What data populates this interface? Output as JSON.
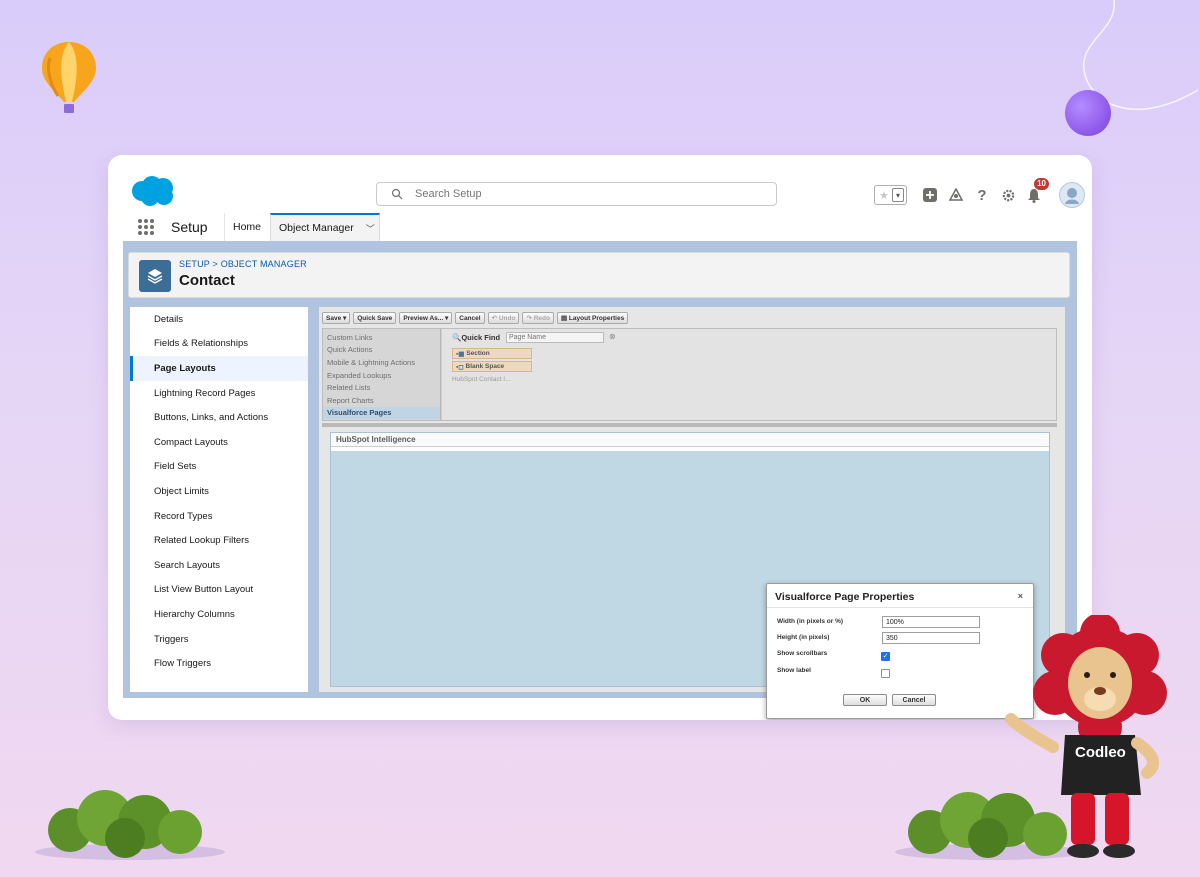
{
  "header": {
    "search_placeholder": "Search Setup",
    "notification_count": "10",
    "icons": [
      "star-icon",
      "add-icon",
      "trailhead-icon",
      "help-icon",
      "settings-icon",
      "bell-icon",
      "avatar"
    ]
  },
  "nav": {
    "app_name": "Setup",
    "tabs": [
      {
        "label": "Home"
      },
      {
        "label": "Object Manager"
      }
    ]
  },
  "page_header": {
    "breadcrumb": "SETUP > OBJECT MANAGER",
    "title": "Contact"
  },
  "sidebar": {
    "items": [
      {
        "label": "Details"
      },
      {
        "label": "Fields & Relationships"
      },
      {
        "label": "Page Layouts",
        "active": true
      },
      {
        "label": "Lightning Record Pages"
      },
      {
        "label": "Buttons, Links, and Actions"
      },
      {
        "label": "Compact Layouts"
      },
      {
        "label": "Field Sets"
      },
      {
        "label": "Object Limits"
      },
      {
        "label": "Record Types"
      },
      {
        "label": "Related Lookup Filters"
      },
      {
        "label": "Search Layouts"
      },
      {
        "label": "List View Button Layout"
      },
      {
        "label": "Hierarchy Columns"
      },
      {
        "label": "Triggers"
      },
      {
        "label": "Flow Triggers"
      }
    ]
  },
  "toolbar": {
    "buttons": [
      {
        "label": "Save ▾"
      },
      {
        "label": "Quick Save"
      },
      {
        "label": "Preview As... ▾"
      },
      {
        "label": "Cancel"
      },
      {
        "label": "Undo",
        "disabled": true
      },
      {
        "label": "Redo",
        "disabled": true
      },
      {
        "label": "Layout Properties"
      }
    ]
  },
  "palette": {
    "categories": [
      {
        "label": "Custom Links"
      },
      {
        "label": "Quick Actions"
      },
      {
        "label": "Mobile & Lightning Actions"
      },
      {
        "label": "Expanded Lookups"
      },
      {
        "label": "Related Lists"
      },
      {
        "label": "Report Charts"
      },
      {
        "label": "Visualforce Pages",
        "active": true
      }
    ],
    "quick_find_label": "Quick Find",
    "quick_find_placeholder": "Page Name",
    "items": [
      {
        "label": "Section"
      },
      {
        "label": "Blank Space"
      },
      {
        "label": "HubSpot Contact I..."
      }
    ]
  },
  "canvas": {
    "section_title": "HubSpot Intelligence"
  },
  "modal": {
    "title": "Visualforce Page Properties",
    "close_label": "×",
    "fields": {
      "width_label": "Width (in pixels or %)",
      "width_value": "100%",
      "height_label": "Height (in pixels)",
      "height_value": "350",
      "scrollbars_label": "Show scrollbars",
      "scrollbars_checked": true,
      "label_label": "Show label",
      "label_checked": false
    },
    "ok_label": "OK",
    "cancel_label": "Cancel"
  },
  "mascot": {
    "shirt_text": "Codleo"
  },
  "colors": {
    "brand_blue": "#0176d3",
    "object_icon": "#3c6d96",
    "background_lavender": "#d9ccfa",
    "workspace_blue": "#b0c4df",
    "badge_red": "#c23934"
  }
}
